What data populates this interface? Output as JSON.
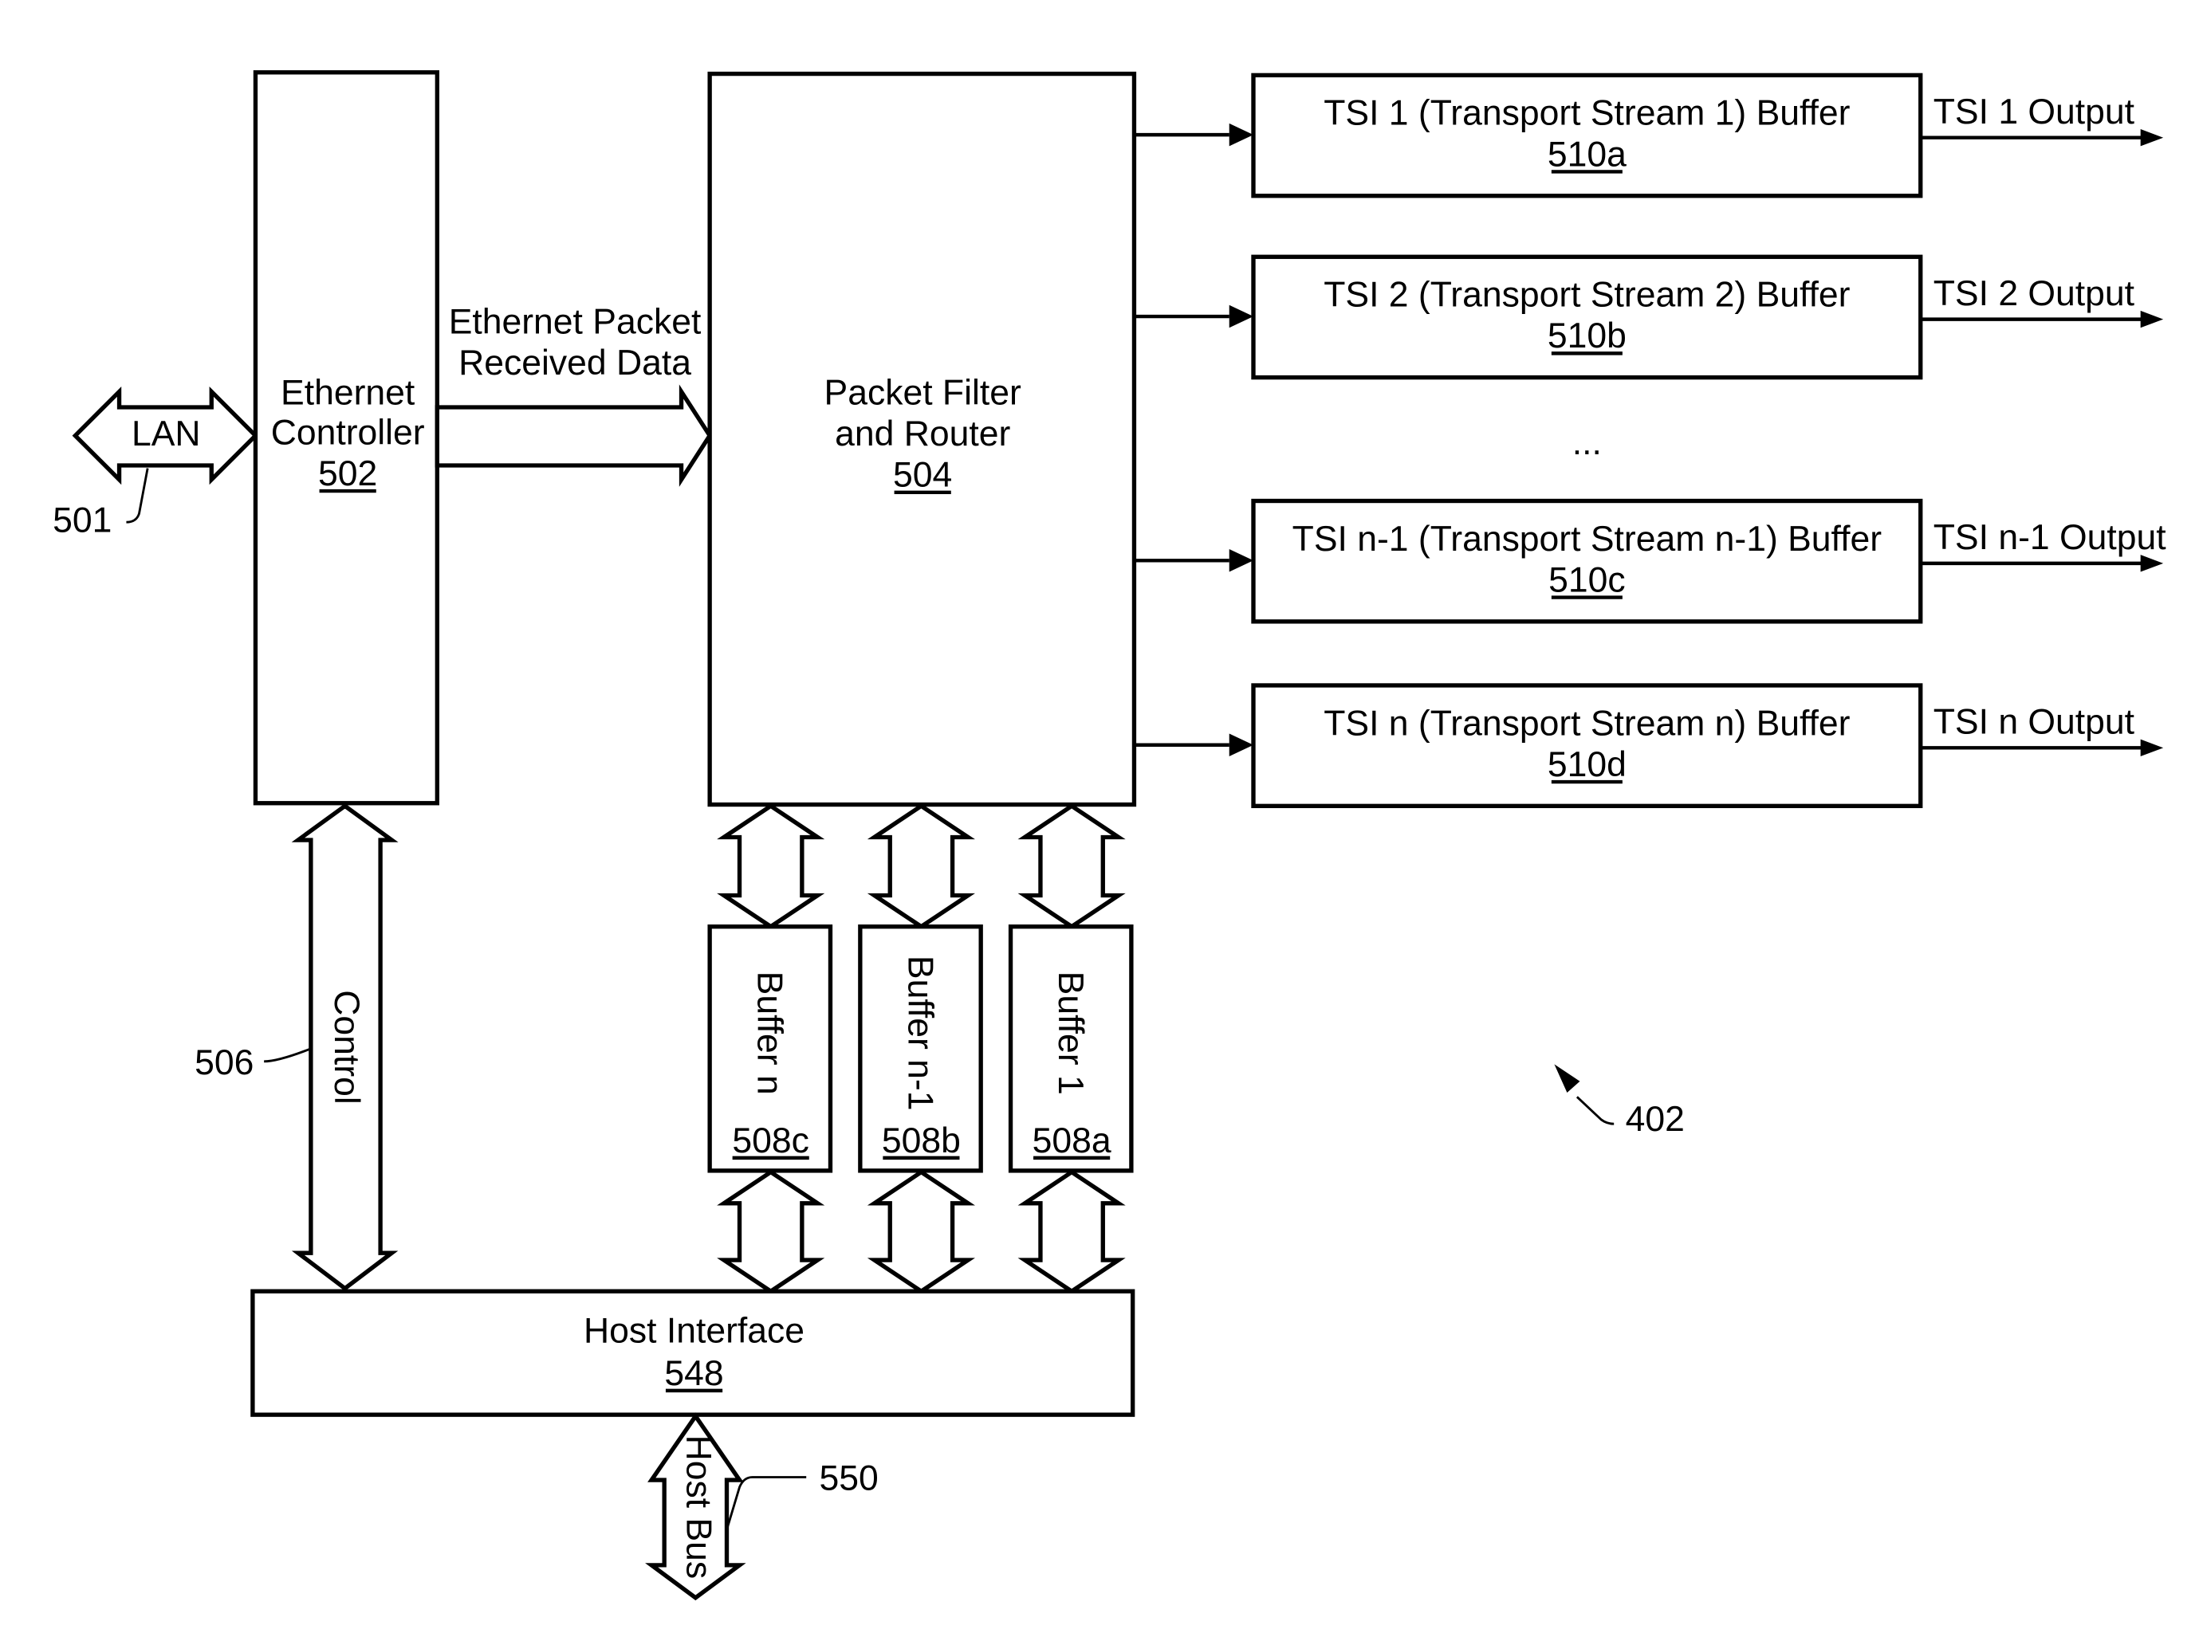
{
  "figure": {
    "reference_label": "402",
    "ellipsis": "..."
  },
  "lan": {
    "label": "LAN",
    "ref": "501"
  },
  "ethernet_controller": {
    "line1": "Ethernet",
    "line2": "Controller",
    "ref": "502"
  },
  "ethernet_packet_bus": {
    "line1": "Ethernet Packet",
    "line2": "Received Data"
  },
  "packet_filter": {
    "line1": "Packet Filter",
    "line2": "and Router",
    "ref": "504"
  },
  "tsi_buffers": [
    {
      "label": "TSI 1 (Transport Stream 1) Buffer",
      "ref": "510a",
      "output": "TSI 1 Output"
    },
    {
      "label": "TSI 2 (Transport Stream 2) Buffer",
      "ref": "510b",
      "output": "TSI 2 Output"
    },
    {
      "label": "TSI n-1 (Transport Stream n-1) Buffer",
      "ref": "510c",
      "output": "TSI n-1 Output"
    },
    {
      "label": "TSI n (Transport Stream n) Buffer",
      "ref": "510d",
      "output": "TSI n Output"
    }
  ],
  "control_bus": {
    "label": "Control",
    "ref": "506"
  },
  "buffers": [
    {
      "label": "Buffer n",
      "ref": "508c"
    },
    {
      "label": "Buffer n-1",
      "ref": "508b"
    },
    {
      "label": "Buffer 1",
      "ref": "508a"
    }
  ],
  "host_interface": {
    "label": "Host Interface",
    "ref": "548"
  },
  "host_bus": {
    "label": "Host Bus",
    "ref": "550"
  }
}
